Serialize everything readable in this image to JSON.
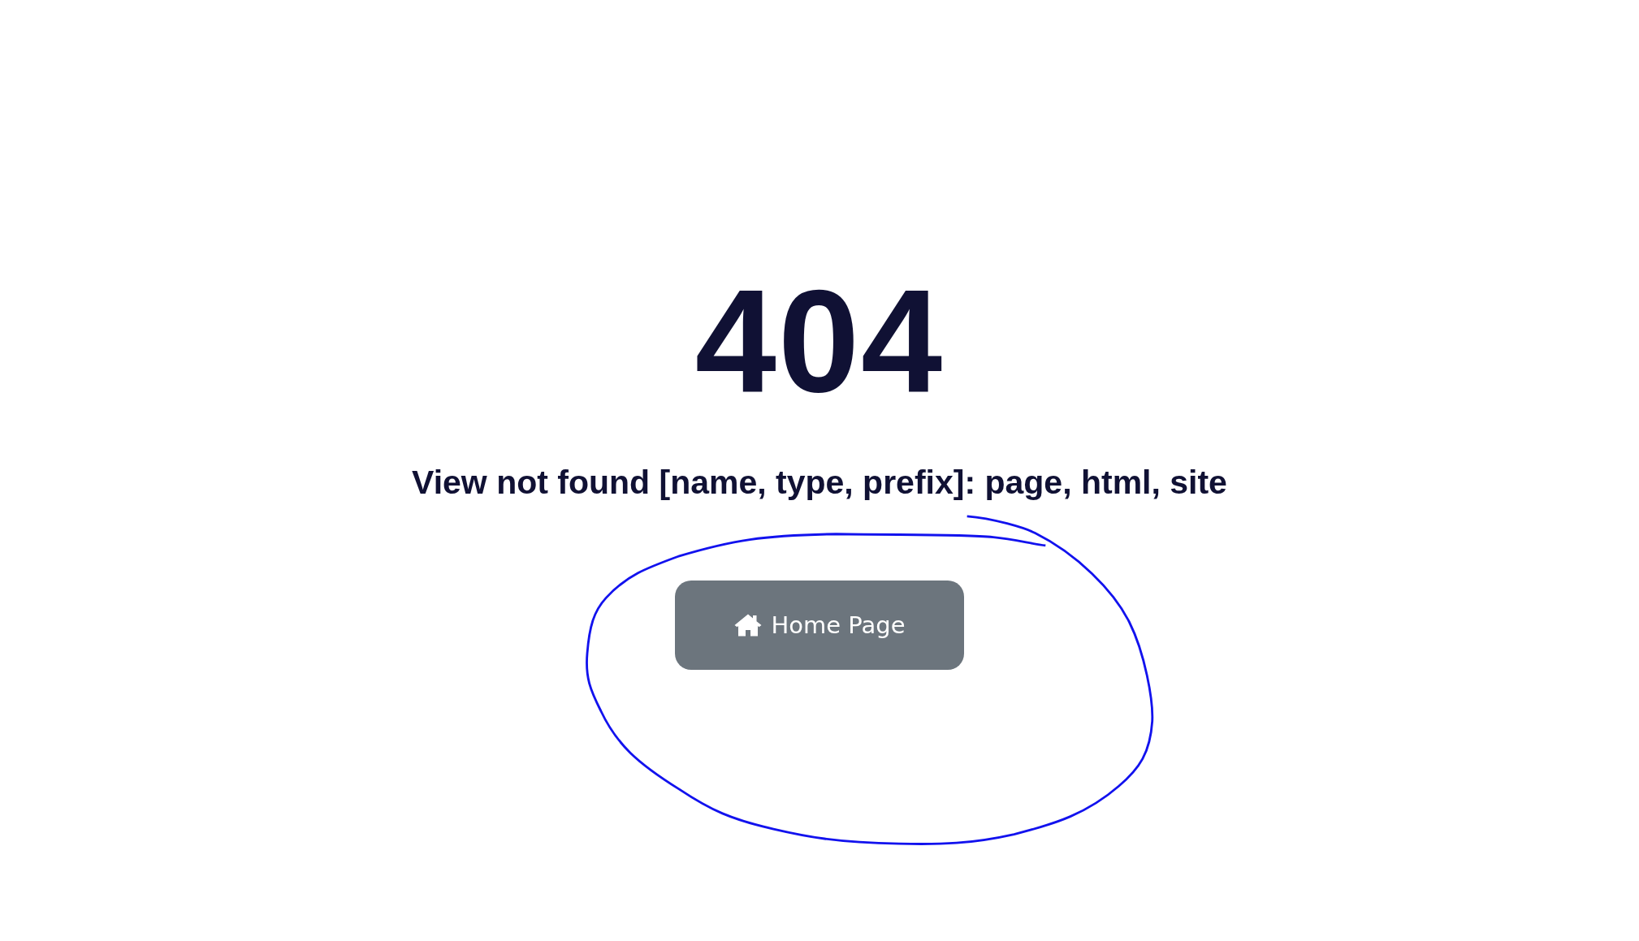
{
  "error": {
    "code": "404",
    "message": "View not found [name, type, prefix]: page, html, site"
  },
  "button": {
    "label": "Home Page"
  },
  "annotation": {
    "kind": "loop"
  }
}
